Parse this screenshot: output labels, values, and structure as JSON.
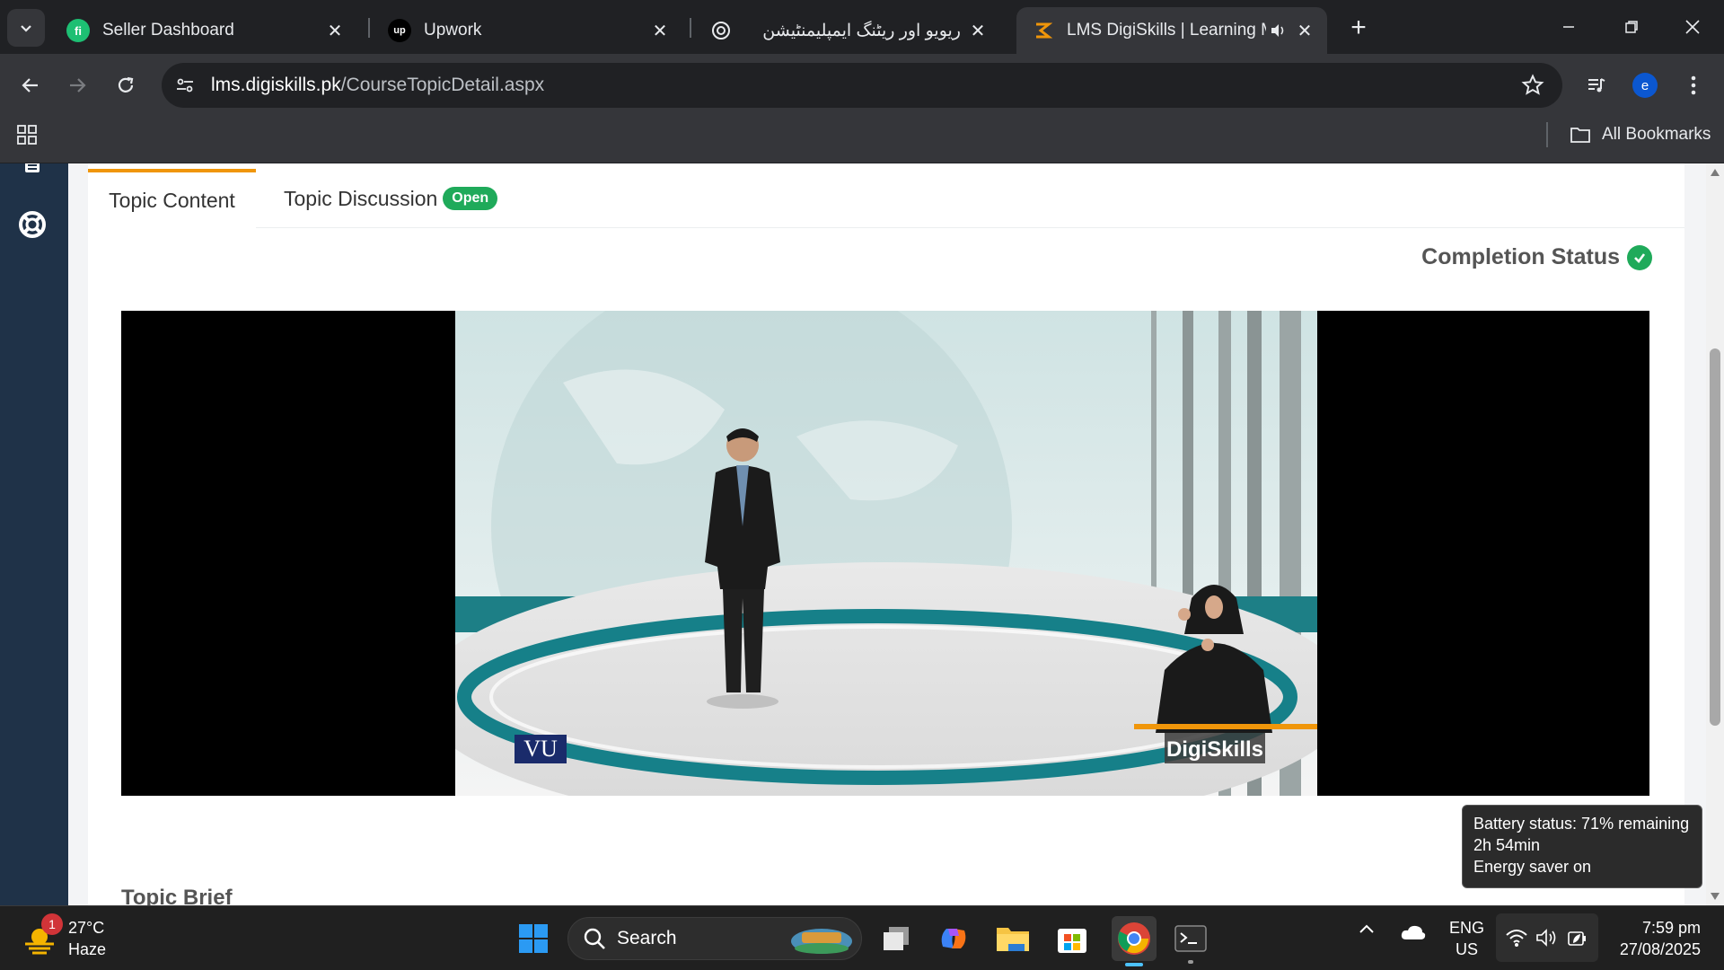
{
  "browser": {
    "tabs": [
      {
        "label": "Seller Dashboard",
        "favicon": "fiverr-icon"
      },
      {
        "label": "Upwork",
        "favicon": "upwork-icon"
      },
      {
        "label": "ریویو اور ریٹنگ ایمپلیمنٹیشن",
        "favicon": "chatgpt-icon"
      },
      {
        "label": "LMS DigiSkills | Learning Ma",
        "favicon": "digiskills-icon",
        "active": true,
        "audio": "speaker-icon"
      }
    ],
    "url_domain": "lms.digiskills.pk",
    "url_path": "/CourseTopicDetail.aspx",
    "profile_initial": "e",
    "bookmarks_label": "All Bookmarks"
  },
  "page": {
    "tabs": [
      {
        "label": "Topic Content",
        "active": true
      },
      {
        "label": "Topic Discussion",
        "badge": "Open"
      }
    ],
    "completion_status": "Completion Status",
    "video_logos": {
      "left": "VU",
      "right": "DigiSkills"
    },
    "topic_brief": "Topic Brief"
  },
  "tooltip": {
    "line1": "Battery status: 71% remaining",
    "line2": "2h 54min",
    "line3": "Energy saver on"
  },
  "taskbar": {
    "notification_count": "1",
    "weather_temp": "27°C",
    "weather_desc": "Haze",
    "search_placeholder": "Search",
    "lang_line1": "ENG",
    "lang_line2": "US",
    "time": "7:59 pm",
    "date": "27/08/2025"
  },
  "colors": {
    "accent": "#f0960a",
    "badge_green": "#1faa5a",
    "rail": "#1f3248"
  }
}
